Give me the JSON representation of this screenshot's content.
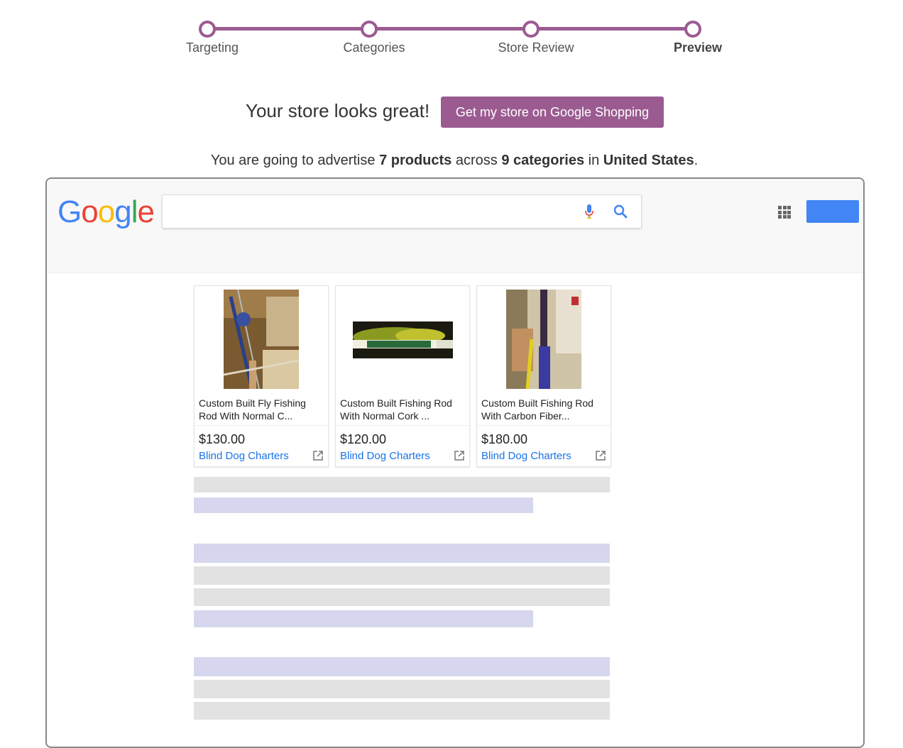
{
  "stepper": {
    "steps": [
      {
        "label": "Targeting",
        "active": false
      },
      {
        "label": "Categories",
        "active": false
      },
      {
        "label": "Store Review",
        "active": false
      },
      {
        "label": "Preview",
        "active": true
      }
    ],
    "color": "#9b5b91"
  },
  "header": {
    "headline": "Your store looks great!",
    "cta_label": "Get my store on Google Shopping"
  },
  "summary": {
    "prefix": "You are going to advertise ",
    "products": "7 products",
    "middle": " across ",
    "categories": "9 categories",
    "in_text": " in ",
    "country": "United States",
    "suffix": "."
  },
  "google": {
    "logo": [
      "G",
      "o",
      "o",
      "g",
      "l",
      "e"
    ],
    "search_placeholder": "",
    "icons": {
      "mic": "microphone-icon",
      "search": "search-icon",
      "apps": "apps-grid-icon"
    },
    "brand_blue": "#4285f4"
  },
  "products": [
    {
      "title": "Custom Built Fly Fishing Rod With Normal C...",
      "price": "$130.00",
      "store": "Blind Dog Charters"
    },
    {
      "title": "Custom Built Fishing Rod With Normal Cork ...",
      "price": "$120.00",
      "store": "Blind Dog Charters"
    },
    {
      "title": "Custom Built Fishing Rod With Carbon Fiber...",
      "price": "$180.00",
      "store": "Blind Dog Charters"
    }
  ]
}
